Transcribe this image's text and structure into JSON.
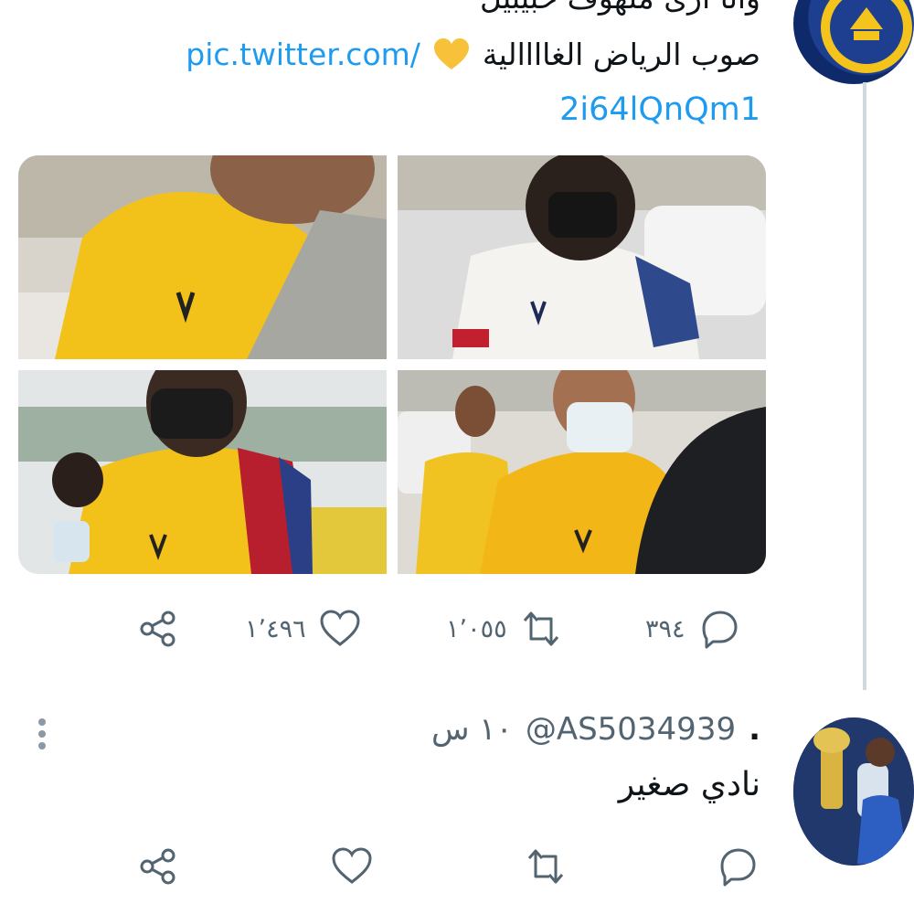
{
  "tweet1": {
    "text_line1": "وأنا أرى ملهوف حبيبيل",
    "text_line2_link": "pic.twitter.com/",
    "text_line2_ar": "صوب الرياض الغاااالية",
    "text_line3_link": "2i64lQnQm1",
    "emoji": "yellow-heart",
    "avatar": "al-nassr-club-logo",
    "photos": [
      "player-yellow-shirt",
      "player-white-shirt-black-mask",
      "player-yellow-shirt-black-mask",
      "player-yellow-jacket-white-mask"
    ],
    "actions": {
      "reply_count": "٣٩٤",
      "retweet_count": "١٬٠٥٥",
      "like_count": "١٬٤٩٦"
    }
  },
  "tweet2": {
    "handle": "@AS5034939",
    "time": "١٠ س",
    "dot": ".",
    "text": "نادي صغير",
    "avatar": "player-with-trophy"
  },
  "colors": {
    "link": "#1d9bf0",
    "icon": "#536471",
    "thread_line": "#cfd9de",
    "emoji_heart": "#f7c23a"
  }
}
